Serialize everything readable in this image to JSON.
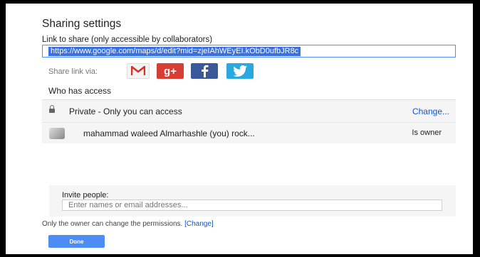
{
  "dialog": {
    "title": "Sharing settings",
    "link_label": "Link to share (only accessible by collaborators)",
    "link_value": "https://www.google.com/maps/d/edit?mid=zjeIAhWEyEI.kObD0ufbJR8c",
    "share_via_label": "Share link via:",
    "share_icons": [
      "gmail-icon",
      "google-plus-icon",
      "facebook-icon",
      "twitter-icon"
    ],
    "who_has_access": "Who has access",
    "access_rows": [
      {
        "icon": "lock-icon",
        "text": "Private - Only you can access",
        "action": "Change..."
      },
      {
        "icon": "avatar",
        "text": "mahammad waleed Almarhashle (you) rock...",
        "role": "Is owner"
      }
    ],
    "invite_label": "Invite people:",
    "invite_placeholder": "Enter names or email addresses...",
    "permissions_note": "Only the owner can change the permissions.",
    "permissions_link": "[Change]",
    "done_label": "Done"
  },
  "colors": {
    "accent": "#4c8df5",
    "link": "#1155cc",
    "gplus": "#d73d32",
    "facebook": "#3b5998",
    "twitter": "#2aa9e0"
  }
}
